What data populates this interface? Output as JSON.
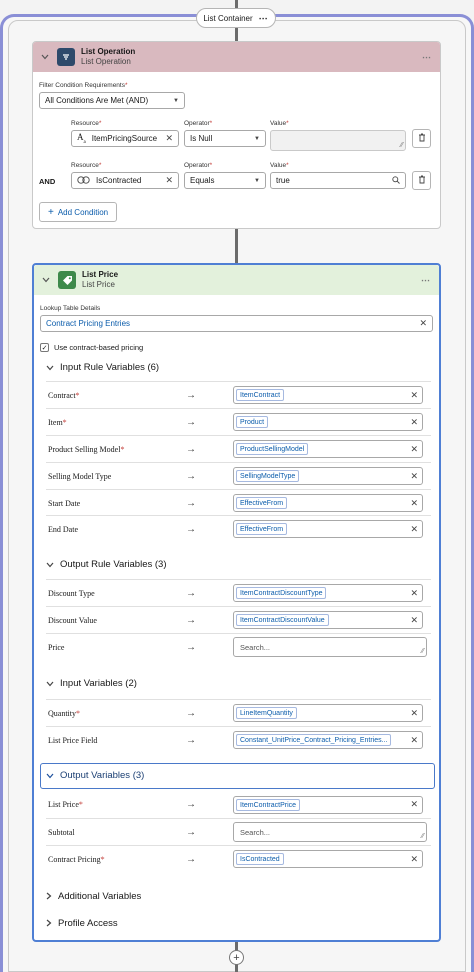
{
  "container": {
    "label": "List Container",
    "menu": "⋯"
  },
  "list_operation": {
    "title": "List Operation",
    "subtitle": "List Operation",
    "menu": "⋯",
    "filter_label": "Filter Condition Requirements",
    "filter_value": "All Conditions Are Met (AND)",
    "resource_label": "Resource",
    "operator_label": "Operator",
    "value_label": "Value",
    "and_label": "AND",
    "conditions": [
      {
        "resource": "ItemPricingSource",
        "operator": "Is Null",
        "value": ""
      },
      {
        "resource": "IsContracted",
        "operator": "Equals",
        "value": "true"
      }
    ],
    "add_condition": "Add Condition"
  },
  "list_price": {
    "title": "List Price",
    "subtitle": "List Price",
    "menu": "⋯",
    "lookup_label": "Lookup Table Details",
    "lookup_value": "Contract Pricing Entries",
    "checkbox_label": "Use contract-based pricing",
    "checkbox_checked": true,
    "sections": {
      "input_rule": {
        "title": "Input Rule Variables (6)",
        "rows": [
          {
            "label": "Contract",
            "required": true,
            "value": "ItemContract"
          },
          {
            "label": "Item",
            "required": true,
            "value": "Product"
          },
          {
            "label": "Product Selling Model",
            "required": true,
            "value": "ProductSellingModel"
          },
          {
            "label": "Selling Model Type",
            "required": false,
            "value": "SellingModelType"
          },
          {
            "label": "Start Date",
            "required": false,
            "value": "EffectiveFrom"
          },
          {
            "label": "End Date",
            "required": false,
            "value": "EffectiveFrom"
          }
        ]
      },
      "output_rule": {
        "title": "Output Rule Variables (3)",
        "rows": [
          {
            "label": "Discount Type",
            "required": false,
            "value": "ItemContractDiscountType"
          },
          {
            "label": "Discount Value",
            "required": false,
            "value": "ItemContractDiscountValue"
          },
          {
            "label": "Price",
            "required": false,
            "placeholder": "Search..."
          }
        ]
      },
      "input_vars": {
        "title": "Input Variables (2)",
        "rows": [
          {
            "label": "Quantity",
            "required": true,
            "value": "LineItemQuantity"
          },
          {
            "label": "List Price Field",
            "required": false,
            "value": "Constant_UnitPrice_Contract_Pricing_Entries..."
          }
        ]
      },
      "output_vars": {
        "title": "Output Variables (3)",
        "rows": [
          {
            "label": "List Price",
            "required": true,
            "value": "ItemContractPrice"
          },
          {
            "label": "Subtotal",
            "required": false,
            "placeholder": "Search..."
          },
          {
            "label": "Contract Pricing",
            "required": true,
            "value": "IsContracted"
          }
        ]
      },
      "additional": {
        "title": "Additional Variables"
      },
      "profile": {
        "title": "Profile Access"
      }
    }
  },
  "glyphs": {
    "arrow": "→",
    "clear": "✕",
    "asterisk": "*",
    "add": "+"
  },
  "colors": {
    "op_header": "#d9b9bf",
    "price_header": "#e3f1dc",
    "op_icon": "#2e4a6b",
    "price_icon": "#3e8a4b",
    "accent": "#0b5cab"
  }
}
